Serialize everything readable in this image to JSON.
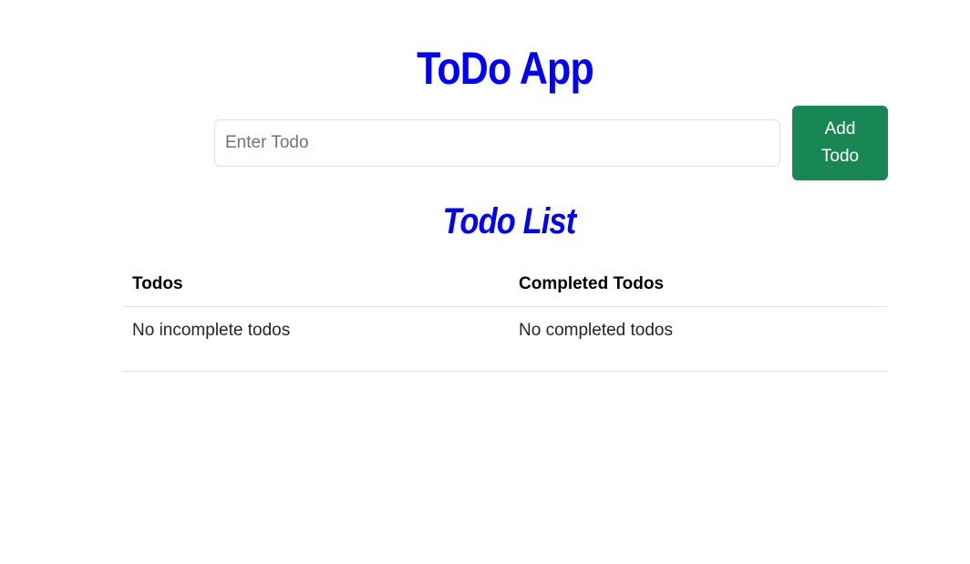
{
  "header": {
    "title": "ToDo App"
  },
  "form": {
    "input_placeholder": "Enter Todo",
    "input_value": "",
    "add_button_label": "Add Todo"
  },
  "list": {
    "title": "Todo List",
    "columns": [
      "Todos",
      "Completed Todos"
    ],
    "incomplete_empty_text": "No incomplete todos",
    "completed_empty_text": "No completed todos"
  },
  "colors": {
    "title": "#0000ff",
    "add_button": "#198754",
    "border": "#dee2e6"
  }
}
